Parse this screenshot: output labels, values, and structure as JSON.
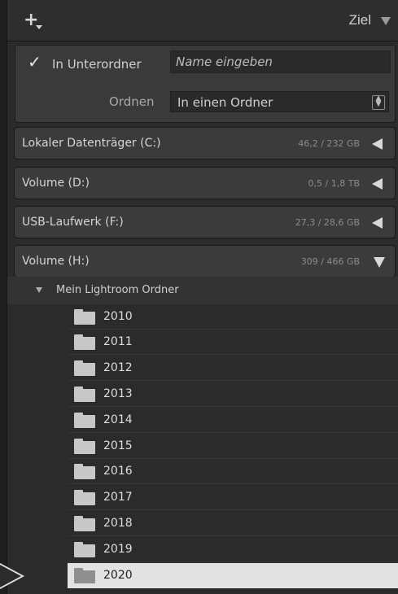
{
  "header": {
    "title": "Ziel"
  },
  "options": {
    "subfolder_label": "In Unterordner",
    "subfolder_checked": true,
    "name_placeholder": "Name eingeben",
    "organize_label": "Ordnen",
    "organize_value": "In einen Ordner"
  },
  "volumes": [
    {
      "name": "Lokaler Datenträger (C:)",
      "size": "46,2 / 232 GB",
      "expanded": false
    },
    {
      "name": "Volume (D:)",
      "size": "0,5 / 1,8 TB",
      "expanded": false
    },
    {
      "name": "USB-Laufwerk (F:)",
      "size": "27,3 / 28,6 GB",
      "expanded": false
    },
    {
      "name": "Volume (H:)",
      "size": "309 / 466 GB",
      "expanded": true
    }
  ],
  "tree": {
    "root_folder": "Mein Lightroom Ordner",
    "folders": [
      "2010",
      "2011",
      "2012",
      "2013",
      "2014",
      "2015",
      "2016",
      "2017",
      "2018",
      "2019",
      "2020"
    ],
    "selected": "2020"
  },
  "colors": {
    "panel_bg": "#2b2b2b",
    "volume_bg": "#3b3b3b",
    "selection_bg": "#e2e2e2"
  }
}
